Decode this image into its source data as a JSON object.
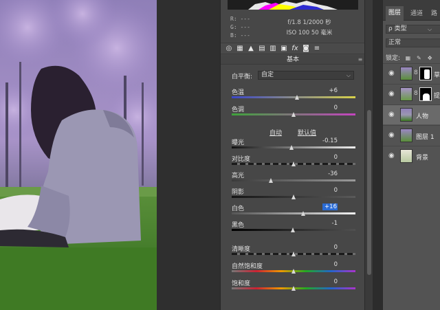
{
  "camera_raw": {
    "rgb_readout": {
      "r": "R:  ---",
      "g": "G:  ---",
      "b": "B:  ---"
    },
    "camera_info": {
      "aperture_shutter": "f/1.8  1/2000 秒",
      "iso_focal": "ISO 100  50 毫米"
    },
    "toolbar_icons": [
      "basic-icon",
      "tone-curve-icon",
      "detail-icon",
      "hsl-icon",
      "split-toning-icon",
      "lens-icon",
      "fx-icon",
      "camera-calibration-icon",
      "presets-icon"
    ],
    "section_title": "基本",
    "white_balance": {
      "label": "白平衡:",
      "value": "自定"
    },
    "temperature": {
      "label": "色温",
      "value": "+6",
      "level": 0.53
    },
    "tint": {
      "label": "色调",
      "value": "0",
      "level": 0.5
    },
    "links": {
      "auto": "自动",
      "default": "默认值"
    },
    "exposure": {
      "label": "曝光",
      "value": "-0.15",
      "level": 0.485
    },
    "contrast": {
      "label": "对比度",
      "value": "0",
      "level": 0.5
    },
    "highlights": {
      "label": "高光",
      "value": "-36",
      "level": 0.32
    },
    "shadows": {
      "label": "阴影",
      "value": "0",
      "level": 0.5
    },
    "whites": {
      "label": "白色",
      "value": "+16",
      "level": 0.58
    },
    "blacks": {
      "label": "黑色",
      "value": "-1",
      "level": 0.495
    },
    "clarity": {
      "label": "清晰度",
      "value": "0",
      "level": 0.5
    },
    "vibrance": {
      "label": "自然饱和度",
      "value": "0",
      "level": 0.5
    },
    "saturation": {
      "label": "饱和度",
      "value": "0",
      "level": 0.5
    }
  },
  "layers_panel": {
    "tabs": [
      "图层",
      "通道",
      "路"
    ],
    "filter": {
      "label": "ρ 类型"
    },
    "blend_mode": "正常",
    "lock_label": "锁定:",
    "layers": [
      {
        "name": "草",
        "selected": false,
        "has_mask": true
      },
      {
        "name": "提",
        "selected": false,
        "has_mask": true
      },
      {
        "name": "人物",
        "selected": true,
        "has_mask": false
      },
      {
        "name": "图层 1",
        "selected": false,
        "has_mask": false
      },
      {
        "name": "背景",
        "selected": false,
        "has_mask": false
      }
    ]
  },
  "colors": {
    "panel_bg": "#474747",
    "accent": "#2a6bd4",
    "layers_bg": "#535353"
  }
}
